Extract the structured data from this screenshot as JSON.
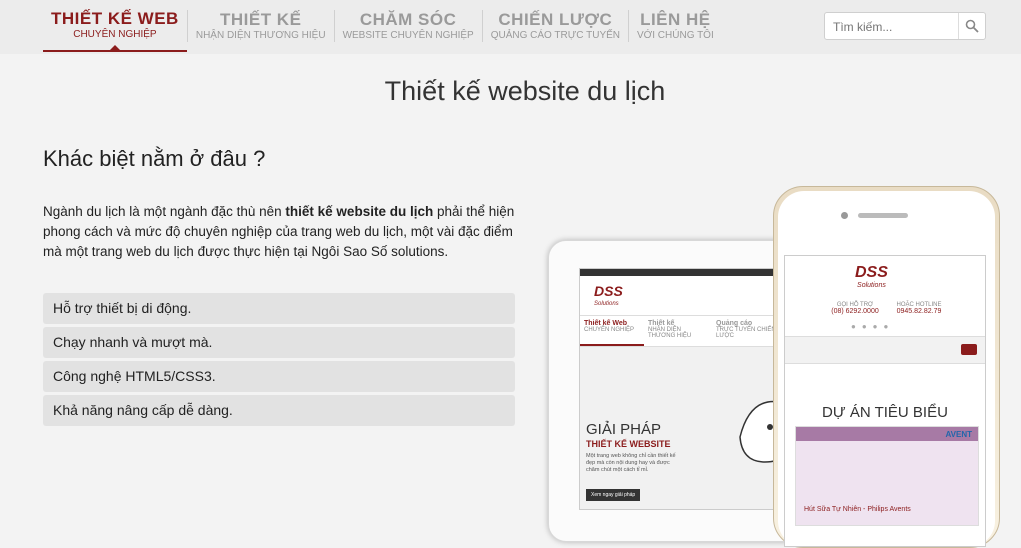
{
  "nav": {
    "items": [
      {
        "title": "THIẾT KẾ WEB",
        "sub": "CHUYÊN NGHIỆP"
      },
      {
        "title": "THIẾT KẾ",
        "sub": "NHẬN DIỆN THƯƠNG HIỆU"
      },
      {
        "title": "CHĂM SÓC",
        "sub": "WEBSITE CHUYÊN NGHIỆP"
      },
      {
        "title": "CHIẾN LƯỢC",
        "sub": "QUẢNG CÁO TRỰC TUYẾN"
      },
      {
        "title": "LIÊN HỆ",
        "sub": "VỚI CHÚNG TÔI"
      }
    ],
    "active_index": 0
  },
  "search": {
    "placeholder": "Tìm kiếm..."
  },
  "page": {
    "title": "Thiết kế website du lịch",
    "heading": "Khác biệt nằm ở đâu ?",
    "para_before": "Ngành du lịch là một ngành đặc thù nên ",
    "para_bold": "thiết kế website du lịch",
    "para_after": " phải thể hiện phong cách và mức độ chuyên nghiệp của trang web du lịch, một vài đặc điểm mà một trang web du lịch được thực hiện tại Ngôi Sao Số solutions.",
    "features": [
      "Hỗ trợ thiết bị di động.",
      "Chạy nhanh và mượt mà.",
      "Công nghệ HTML5/CSS3.",
      "Khả năng nâng cấp dễ dàng."
    ]
  },
  "tablet": {
    "logo": "DSS",
    "logo_sub": "Solutions",
    "nav": [
      "Thiết kế Web",
      "Thiết kế",
      "Quảng cáo"
    ],
    "nav_sub": [
      "CHUYÊN NGHIỆP",
      "NHẬN DIỆN THƯƠNG HIỆU",
      "TRỰC TUYẾN CHIẾN LƯỢC"
    ],
    "headline": "GIẢI PHÁP",
    "subheadline": "THIẾT KẾ WEBSITE",
    "body": "Một trang web không chỉ cần thiết kế đẹp mà còn nội dung hay và được chăm chút một cách tỉ mỉ.",
    "button": "Xem ngay giải pháp"
  },
  "phone": {
    "logo": "DSS",
    "logo_sub": "Solutions",
    "contact1_label": "GỌI HỖ TRỢ",
    "contact1_value": "(08) 6292.0000",
    "contact2_label": "HOẶC HOTLINE",
    "contact2_value": "0945.82.82.79",
    "section_title": "DỰ ÁN TIÊU BIỂU",
    "project_caption": "Hút Sữa Tự Nhiên - Philips Avents",
    "project_brand": "AVENT"
  }
}
